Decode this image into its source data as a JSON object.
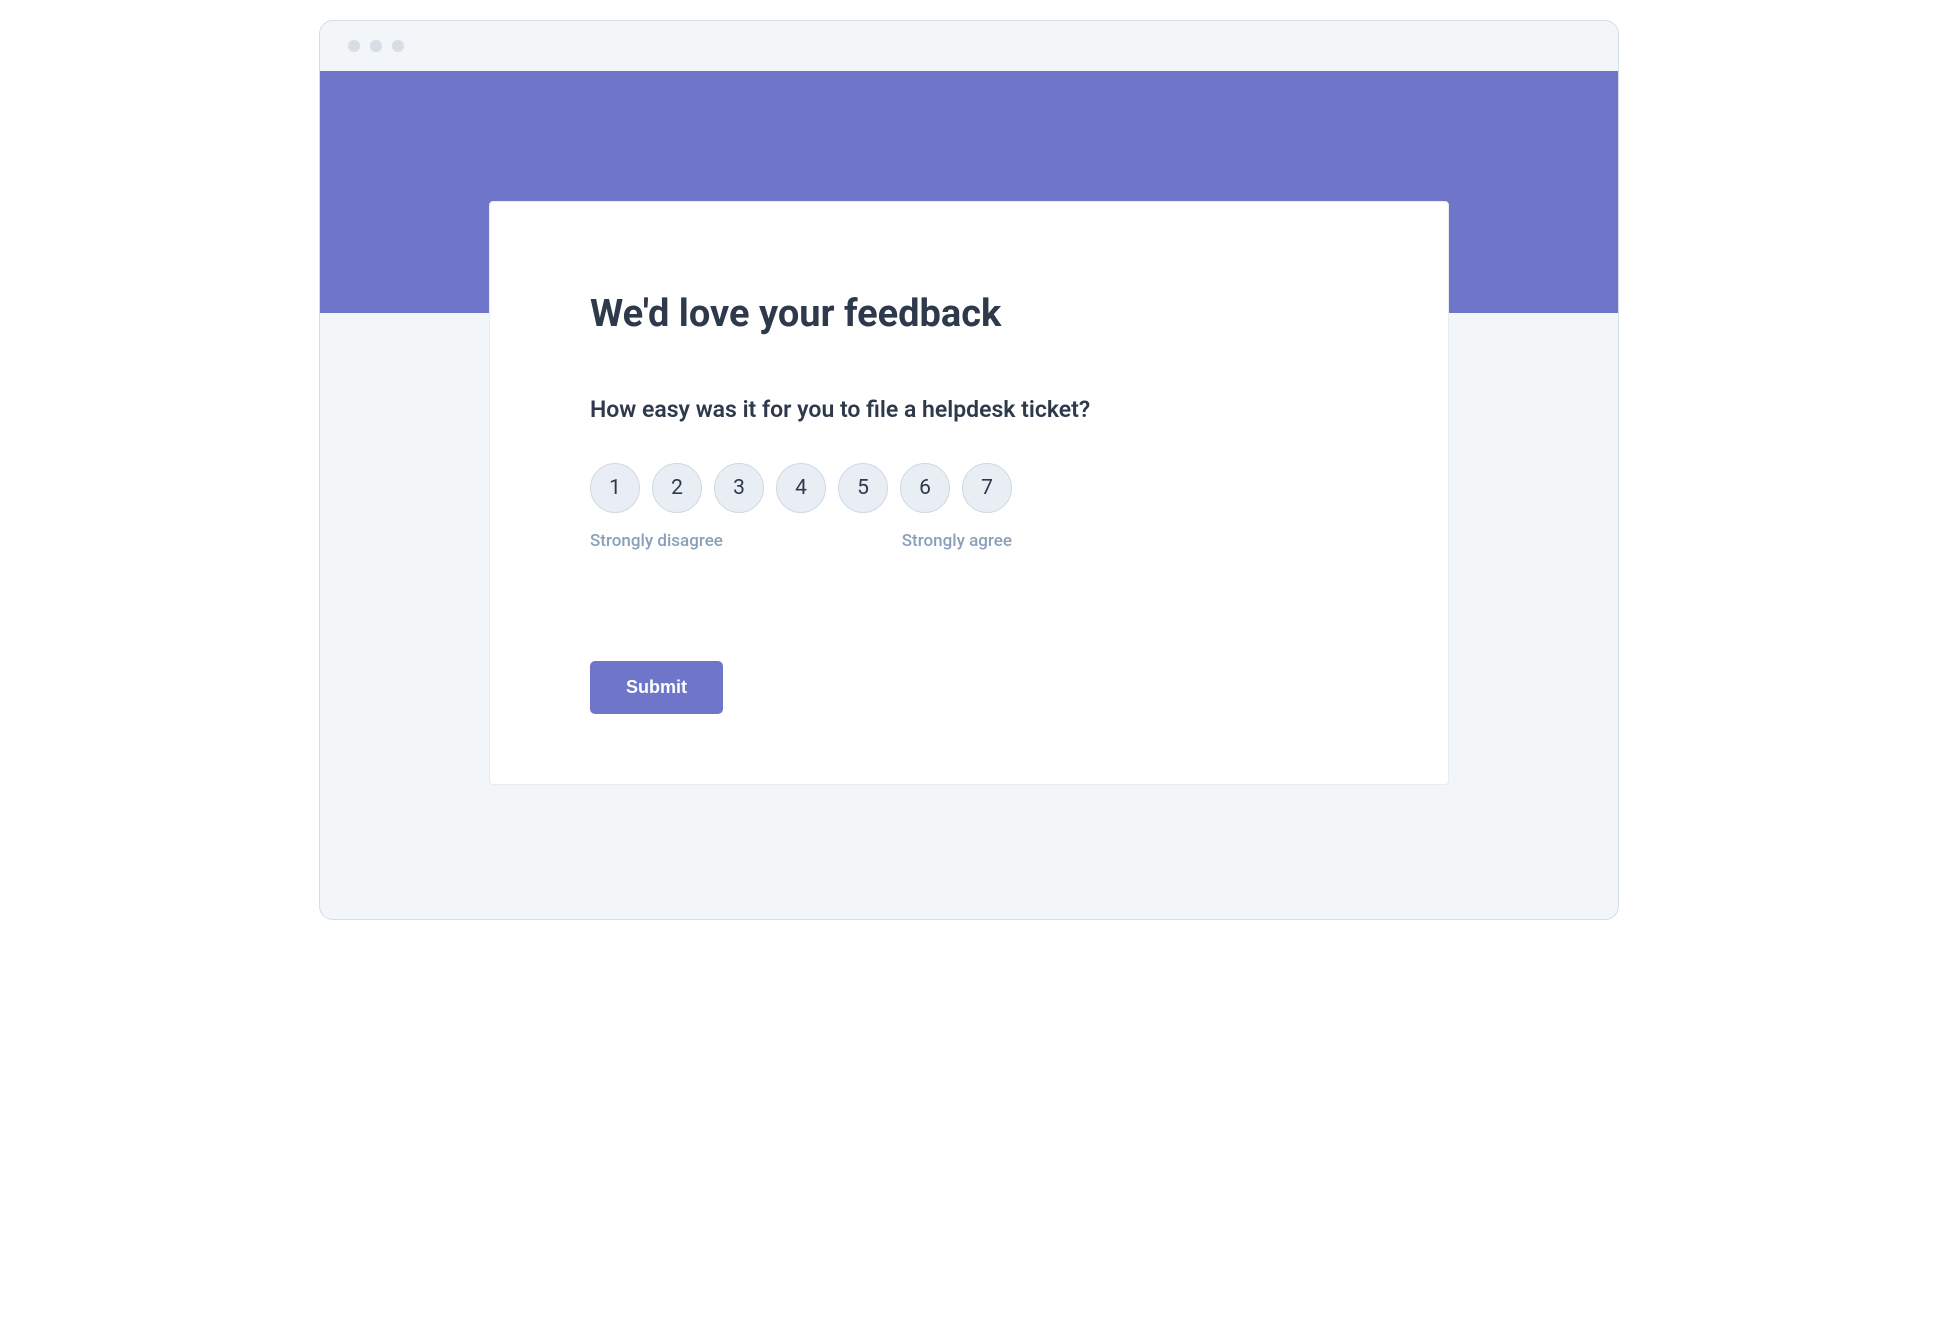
{
  "survey": {
    "title": "We'd love your feedback",
    "question": "How easy was it for you to file a helpdesk ticket?",
    "rating_options": [
      "1",
      "2",
      "3",
      "4",
      "5",
      "6",
      "7"
    ],
    "low_label": "Strongly disagree",
    "high_label": "Strongly agree",
    "submit_label": "Submit"
  },
  "colors": {
    "accent": "#6f76c9",
    "page_bg": "#f2f6f9",
    "text_dark": "#2e3a4b",
    "text_muted": "#8aa0b8",
    "circle_bg": "#e9eef5"
  }
}
